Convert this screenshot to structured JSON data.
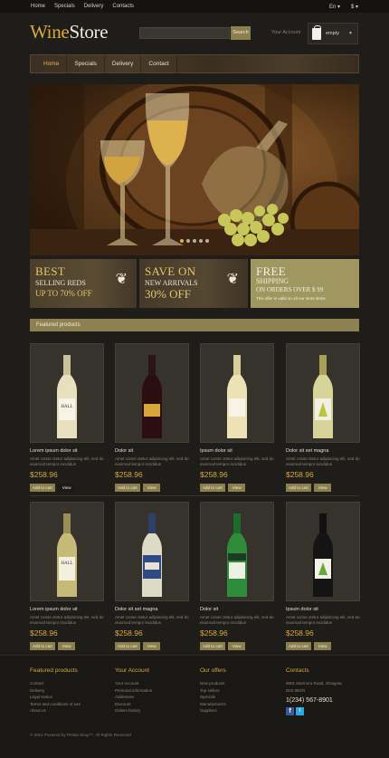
{
  "topbar": {
    "links": [
      "Home",
      "Specials",
      "Delivery",
      "Contacts"
    ],
    "language": "En ▾",
    "currency": "$ ▾"
  },
  "header": {
    "logo_part1": "Wine",
    "logo_part2": "Store",
    "search_button": "Search",
    "account": "Your Account",
    "cart_label": "empty"
  },
  "nav": [
    "Home",
    "Specials",
    "Delivery",
    "Contact"
  ],
  "banners": {
    "b1": {
      "line1": "BEST",
      "line2": "SELLING REDS",
      "line3": "UP TO 70% OFF"
    },
    "b2": {
      "line1": "SAVE ON",
      "line2": "NEW ARRIVALS",
      "line3": "30% OFF"
    },
    "b3": {
      "line1": "FREE",
      "line2": "SHIPPING",
      "line3": "ON ORDERS OVER $ 99",
      "note": "This offer is valid on all our store items"
    }
  },
  "featured_title": "Featured products",
  "products": [
    {
      "name": "Lorem ipsum dolor sit",
      "desc": "Amet conse ctetur adipisicing elit, sed do eiusmod tempor incididun",
      "price": "$258.96",
      "cart": "Add to cart",
      "view": "View"
    },
    {
      "name": "Dolor sit",
      "desc": "Amet conse ctetur adipisicing elit, sed do eiusmod tempor incididun",
      "price": "$258.96",
      "cart": "Add to cart",
      "view": "View"
    },
    {
      "name": "Ipsum dolor sit",
      "desc": "Amet conse ctetur adipisicing elit, sed do eiusmod tempor incididun",
      "price": "$258.96",
      "cart": "Add to cart",
      "view": "View"
    },
    {
      "name": "Dolor sit set magna",
      "desc": "Amet conse ctetur adipisicing elit, sed do eiusmod tempor incididun",
      "price": "$258.96",
      "cart": "Add to cart",
      "view": "View"
    },
    {
      "name": "Lorem ipsum dolor sit",
      "desc": "Amet conse ctetur adipisicing elit, sed do eiusmod tempor incididun",
      "price": "$258.96",
      "cart": "Add to cart",
      "view": "View"
    },
    {
      "name": "Dolor sit set magna",
      "desc": "Amet conse ctetur adipisicing elit, sed do eiusmod tempor incididun",
      "price": "$258.96",
      "cart": "Add to cart",
      "view": "View"
    },
    {
      "name": "Dolor sit",
      "desc": "Amet conse ctetur adipisicing elit, sed do eiusmod tempor incididun",
      "price": "$258.96",
      "cart": "Add to cart",
      "view": "View"
    },
    {
      "name": "Ipsum dolor sit",
      "desc": "Amet conse ctetur adipisicing elit, sed do eiusmod tempor incididun",
      "price": "$258.96",
      "cart": "Add to cart",
      "view": "View"
    }
  ],
  "footer": {
    "col1": {
      "title": "Featured products",
      "links": [
        "Contact",
        "Delivery",
        "Legal Notice",
        "Terms and conditions of use",
        "About us"
      ]
    },
    "col2": {
      "title": "Your Account",
      "links": [
        "Your Account",
        "Personal information",
        "Addresses",
        "Discount",
        "Orders history"
      ]
    },
    "col3": {
      "title": "Our offers",
      "links": [
        "New products",
        "Top sellers",
        "Specials",
        "Manufacturers",
        "Suppliers"
      ]
    },
    "col4": {
      "title": "Contacts",
      "address1": "8901 Marmora Road, Glasgow,",
      "address2": "D04 89GR",
      "phone": "1(234) 567-8901"
    },
    "copyright": "© 2012 Powered by Presta Shop™. All Rights Reserved"
  }
}
